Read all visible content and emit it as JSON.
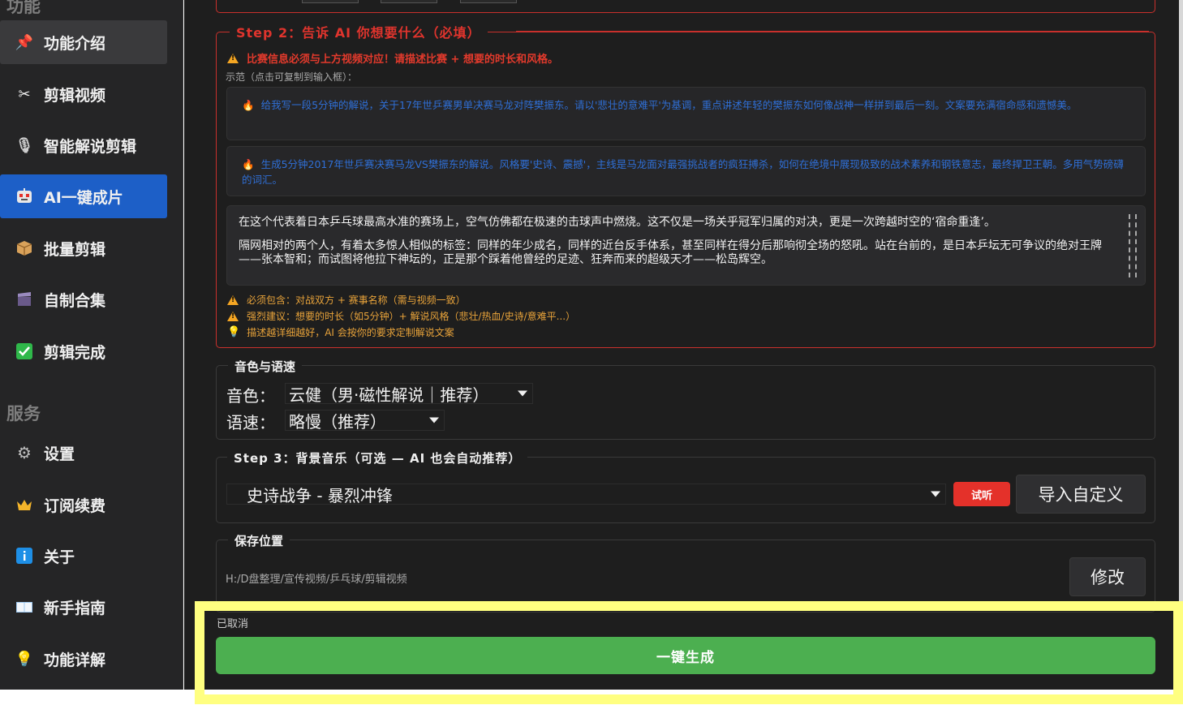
{
  "sidebar": {
    "section_top": "功能",
    "items_func": [
      {
        "label": "功能介绍",
        "icon": "pin-icon"
      },
      {
        "label": "剪辑视频",
        "icon": "scissors-icon"
      },
      {
        "label": "智能解说剪辑",
        "icon": "microphone-icon"
      },
      {
        "label": "AI一键成片",
        "icon": "robot-icon"
      },
      {
        "label": "批量剪辑",
        "icon": "package-icon"
      },
      {
        "label": "自制合集",
        "icon": "clapper-icon"
      },
      {
        "label": "剪辑完成",
        "icon": "check-icon"
      }
    ],
    "section_service": "服务",
    "items_service": [
      {
        "label": "设置",
        "icon": "gear-icon"
      },
      {
        "label": "订阅续费",
        "icon": "crown-icon"
      },
      {
        "label": "关于",
        "icon": "info-icon"
      },
      {
        "label": "新手指南",
        "icon": "book-icon"
      },
      {
        "label": "功能详解",
        "icon": "bulb-icon"
      }
    ]
  },
  "step2": {
    "title": "Step 2：告诉 AI 你想要什么（必填）",
    "warning": "比赛信息必须与上方视频对应！请描述比赛 + 想要的时长和风格。",
    "hint": "示范（点击可复制到输入框）：",
    "examples": [
      "给我写一段5分钟的解说，关于17年世乒赛男单决赛马龙对阵樊振东。请以'悲壮的意难平'为基调，重点讲述年轻的樊振东如何像战神一样拼到最后一刻。文案要充满宿命感和遗憾美。",
      "生成5分钟2017年世乒赛决赛马龙VS樊振东的解说。风格要'史诗、震撼'，主线是马龙面对最强挑战者的疯狂搏杀，如何在绝境中展现极致的战术素养和钢铁意志，最终捍卫王朝。多用气势磅礴的词汇。"
    ],
    "text_para1": "在这个代表着日本乒乓球最高水准的赛场上，空气仿佛都在极速的击球声中燃烧。这不仅是一场关乎冠军归属的对决，更是一次跨越时空的‘宿命重逢’。",
    "text_para2": "隔网相对的两个人，有着太多惊人相似的标签：同样的年少成名，同样的近台反手体系，甚至同样在得分后那响彻全场的怒吼。站在台前的，是日本乒坛无可争议的绝对王牌——张本智和；而试图将他拉下神坛的，正是那个踩着他曾经的足迹、狂奔而来的超级天才——松岛辉空。",
    "notes": [
      "必须包含：对战双方 + 赛事名称（需与视频一致）",
      "强烈建议：想要的时长（如5分钟）+ 解说风格（悲壮/热血/史诗/意难平...）",
      "描述越详细越好，AI 会按你的要求定制解说文案"
    ]
  },
  "voice": {
    "title": "音色与语速",
    "voice_label": "音色：",
    "voice_value": "云健（男·磁性解说｜推荐）",
    "speed_label": "语速：",
    "speed_value": "略慢（推荐）"
  },
  "step3": {
    "title": "Step 3：背景音乐（可选 — AI 也会自动推荐）",
    "music_value": "史诗战争 - 暴烈冲锋",
    "listen_label": "试听",
    "import_label": "导入自定义"
  },
  "save": {
    "title": "保存位置",
    "path": "H:/D盘整理/宣传视频/乒乓球/剪辑视频",
    "modify_label": "修改"
  },
  "footer": {
    "status": "已取消",
    "generate_label": "一键生成"
  },
  "colors": {
    "accent_blue": "#1d5fc7",
    "danger_red": "#e0342d",
    "success_green": "#4caf50",
    "highlight_yellow": "#ffff80"
  }
}
